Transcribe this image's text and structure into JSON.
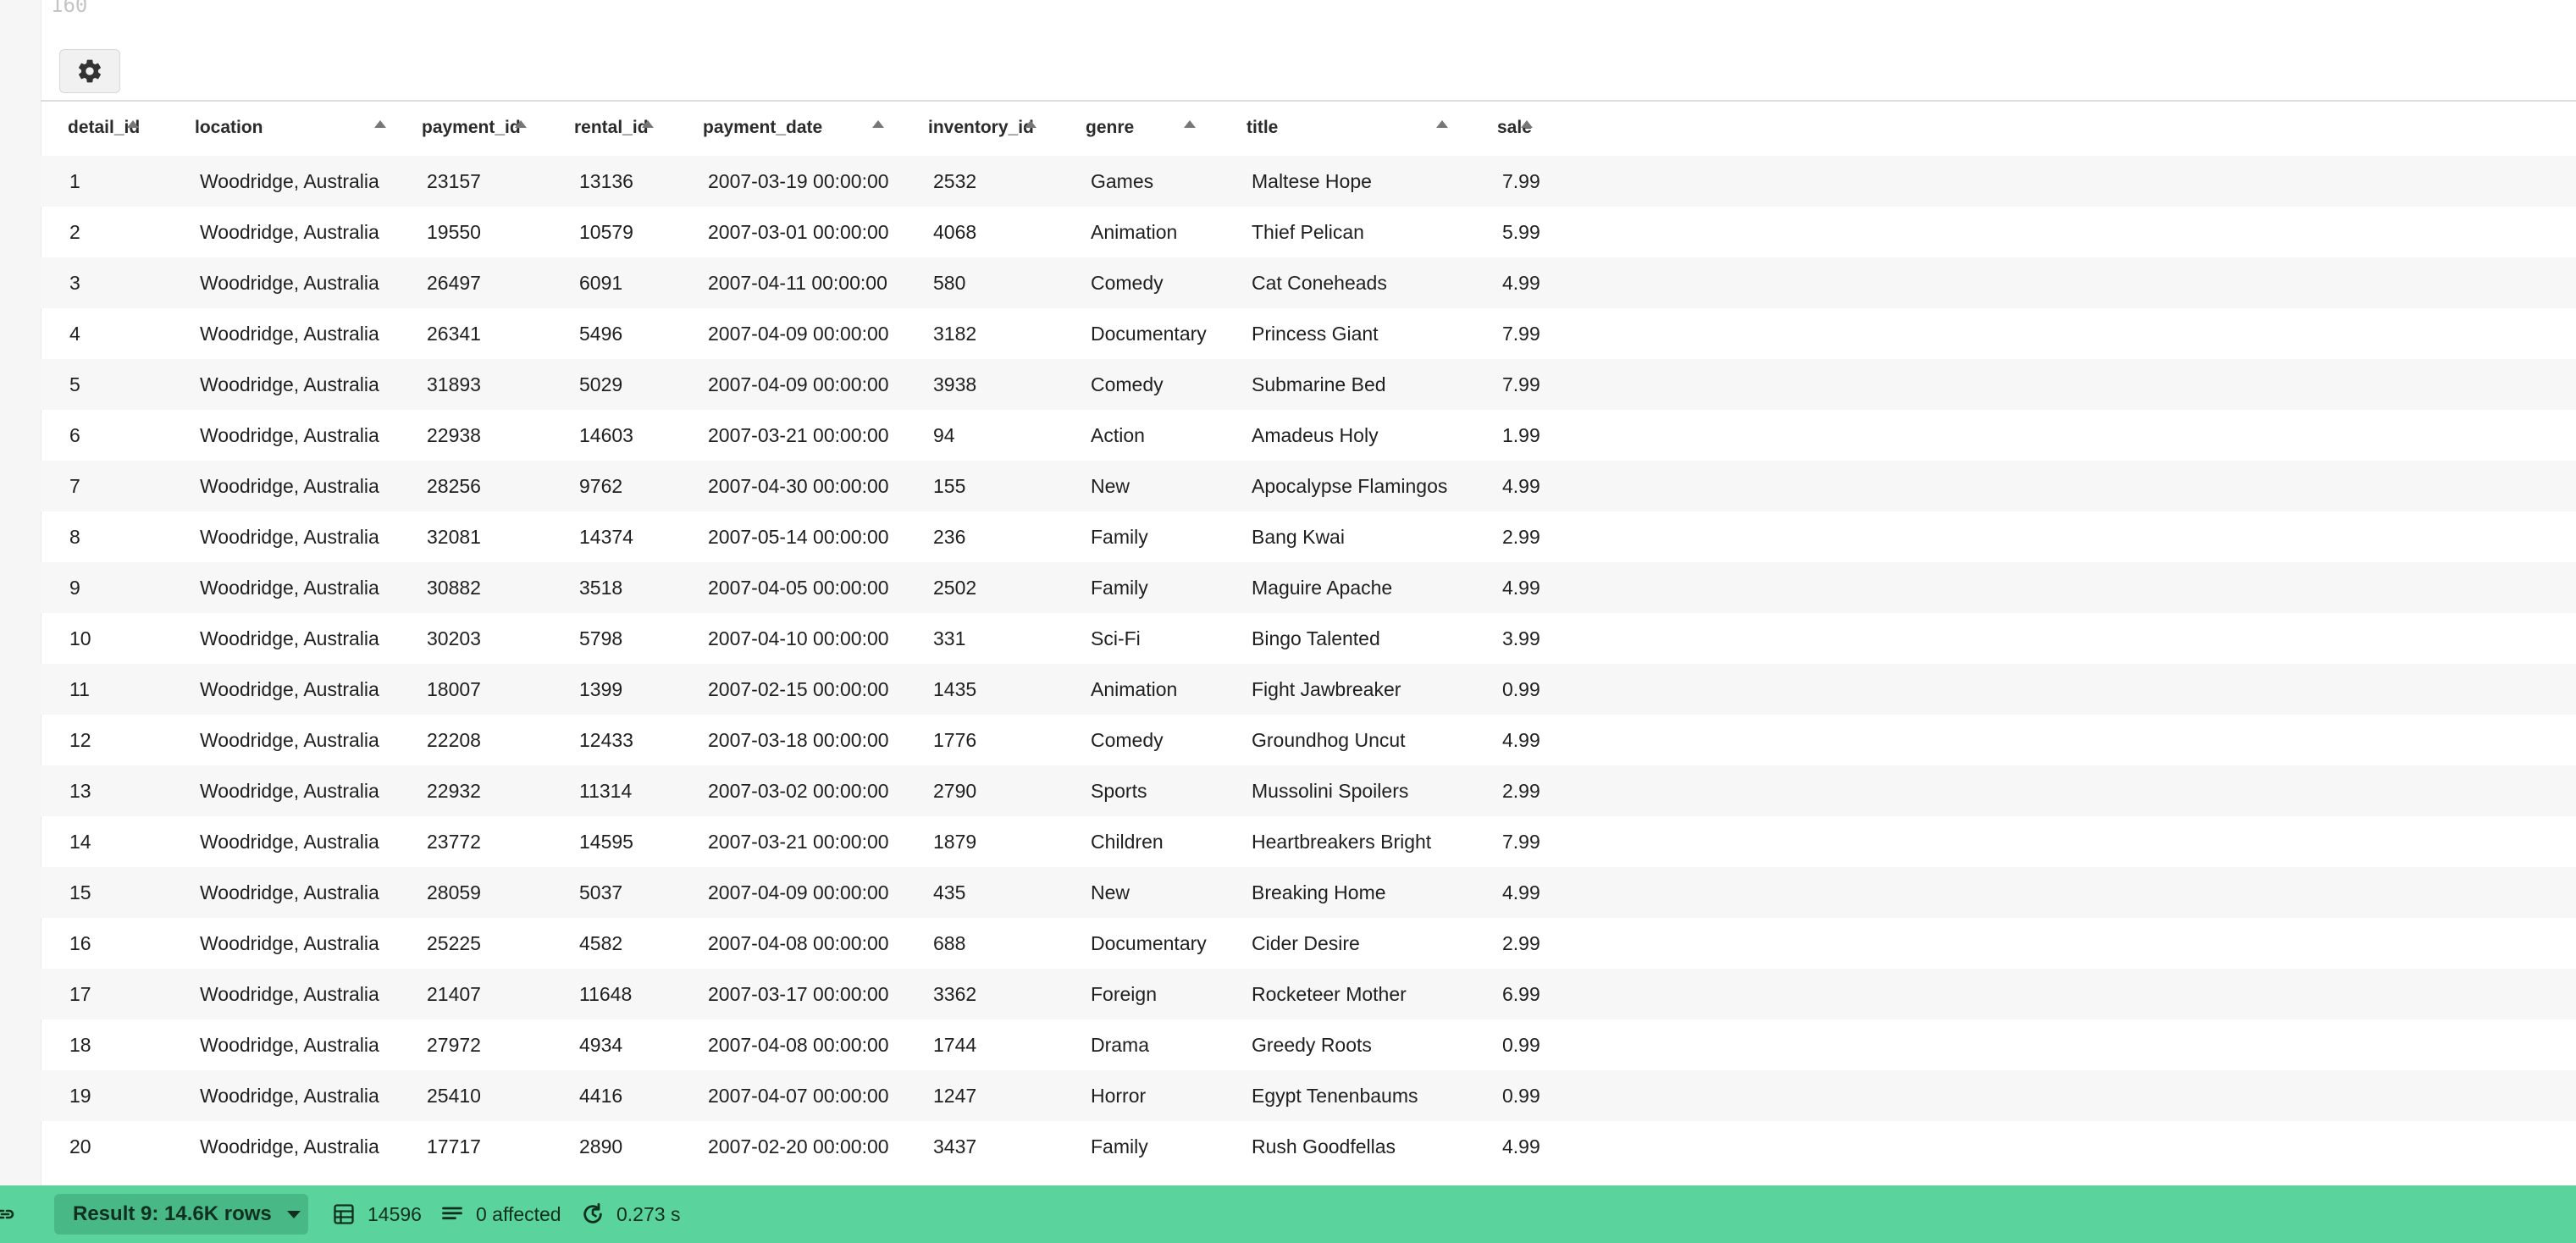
{
  "editor": {
    "line_number": "160"
  },
  "toolbar": {
    "settings_icon": "gear-icon"
  },
  "table": {
    "columns": [
      {
        "label": "detail_id"
      },
      {
        "label": "location"
      },
      {
        "label": "payment_id"
      },
      {
        "label": "rental_id"
      },
      {
        "label": "payment_date"
      },
      {
        "label": "inventory_id"
      },
      {
        "label": "genre"
      },
      {
        "label": "title"
      },
      {
        "label": "sale"
      }
    ],
    "rows": [
      [
        "1",
        "Woodridge, Australia",
        "23157",
        "13136",
        "2007-03-19 00:00:00",
        "2532",
        "Games",
        "Maltese Hope",
        "7.99"
      ],
      [
        "2",
        "Woodridge, Australia",
        "19550",
        "10579",
        "2007-03-01 00:00:00",
        "4068",
        "Animation",
        "Thief Pelican",
        "5.99"
      ],
      [
        "3",
        "Woodridge, Australia",
        "26497",
        "6091",
        "2007-04-11 00:00:00",
        "580",
        "Comedy",
        "Cat Coneheads",
        "4.99"
      ],
      [
        "4",
        "Woodridge, Australia",
        "26341",
        "5496",
        "2007-04-09 00:00:00",
        "3182",
        "Documentary",
        "Princess Giant",
        "7.99"
      ],
      [
        "5",
        "Woodridge, Australia",
        "31893",
        "5029",
        "2007-04-09 00:00:00",
        "3938",
        "Comedy",
        "Submarine Bed",
        "7.99"
      ],
      [
        "6",
        "Woodridge, Australia",
        "22938",
        "14603",
        "2007-03-21 00:00:00",
        "94",
        "Action",
        "Amadeus Holy",
        "1.99"
      ],
      [
        "7",
        "Woodridge, Australia",
        "28256",
        "9762",
        "2007-04-30 00:00:00",
        "155",
        "New",
        "Apocalypse Flamingos",
        "4.99"
      ],
      [
        "8",
        "Woodridge, Australia",
        "32081",
        "14374",
        "2007-05-14 00:00:00",
        "236",
        "Family",
        "Bang Kwai",
        "2.99"
      ],
      [
        "9",
        "Woodridge, Australia",
        "30882",
        "3518",
        "2007-04-05 00:00:00",
        "2502",
        "Family",
        "Maguire Apache",
        "4.99"
      ],
      [
        "10",
        "Woodridge, Australia",
        "30203",
        "5798",
        "2007-04-10 00:00:00",
        "331",
        "Sci-Fi",
        "Bingo Talented",
        "3.99"
      ],
      [
        "11",
        "Woodridge, Australia",
        "18007",
        "1399",
        "2007-02-15 00:00:00",
        "1435",
        "Animation",
        "Fight Jawbreaker",
        "0.99"
      ],
      [
        "12",
        "Woodridge, Australia",
        "22208",
        "12433",
        "2007-03-18 00:00:00",
        "1776",
        "Comedy",
        "Groundhog Uncut",
        "4.99"
      ],
      [
        "13",
        "Woodridge, Australia",
        "22932",
        "11314",
        "2007-03-02 00:00:00",
        "2790",
        "Sports",
        "Mussolini Spoilers",
        "2.99"
      ],
      [
        "14",
        "Woodridge, Australia",
        "23772",
        "14595",
        "2007-03-21 00:00:00",
        "1879",
        "Children",
        "Heartbreakers Bright",
        "7.99"
      ],
      [
        "15",
        "Woodridge, Australia",
        "28059",
        "5037",
        "2007-04-09 00:00:00",
        "435",
        "New",
        "Breaking Home",
        "4.99"
      ],
      [
        "16",
        "Woodridge, Australia",
        "25225",
        "4582",
        "2007-04-08 00:00:00",
        "688",
        "Documentary",
        "Cider Desire",
        "2.99"
      ],
      [
        "17",
        "Woodridge, Australia",
        "21407",
        "11648",
        "2007-03-17 00:00:00",
        "3362",
        "Foreign",
        "Rocketeer Mother",
        "6.99"
      ],
      [
        "18",
        "Woodridge, Australia",
        "27972",
        "4934",
        "2007-04-08 00:00:00",
        "1744",
        "Drama",
        "Greedy Roots",
        "0.99"
      ],
      [
        "19",
        "Woodridge, Australia",
        "25410",
        "4416",
        "2007-04-07 00:00:00",
        "1247",
        "Horror",
        "Egypt Tenenbaums",
        "0.99"
      ],
      [
        "20",
        "Woodridge, Australia",
        "17717",
        "2890",
        "2007-02-20 00:00:00",
        "3437",
        "Family",
        "Rush Goodfellas",
        "4.99"
      ]
    ]
  },
  "status_bar": {
    "result_label": "Result 9: 14.6K rows",
    "row_count": "14596",
    "affected": "0 affected",
    "duration": "0.273 s",
    "icons": {
      "link": "link-icon",
      "table": "table-icon",
      "affected": "rows-icon",
      "duration": "refresh-timer-icon"
    },
    "color": "#5ad49c"
  }
}
